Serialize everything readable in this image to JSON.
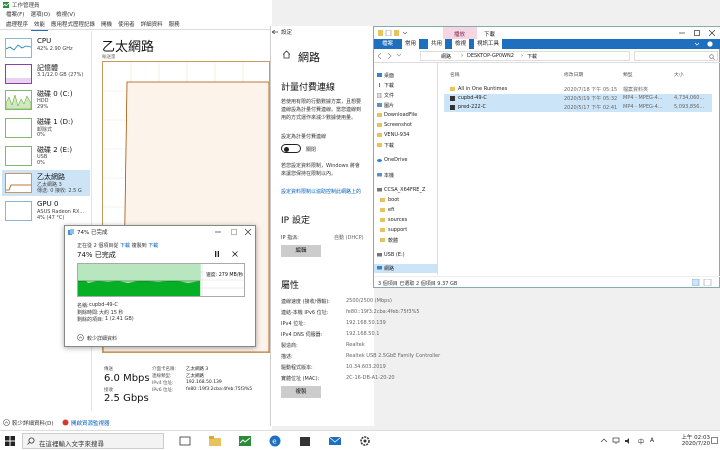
{
  "task_manager": {
    "title": "工作管理員",
    "menu": [
      "檔案(F)",
      "選項(O)",
      "檢視(V)"
    ],
    "tabs": [
      "處理程序",
      "效能",
      "應用程式歷程記錄",
      "開機",
      "使用者",
      "詳細資料",
      "服務"
    ],
    "sidebar": [
      {
        "name": "CPU",
        "l2": "42% 2.90 GHz",
        "l3": ""
      },
      {
        "name": "記憶體",
        "l2": "3.1/12.0 GB (27%)",
        "l3": ""
      },
      {
        "name": "磁碟 0 (C:)",
        "l2": "HDD",
        "l3": "29%"
      },
      {
        "name": "磁碟 1 (D:)",
        "l2": "卸除式",
        "l3": "0%"
      },
      {
        "name": "磁碟 2 (E:)",
        "l2": "USB",
        "l3": "0%"
      },
      {
        "name": "乙太網路",
        "l2": "乙太網路 3",
        "l3": "傳送: 0 接收: 2.5 G"
      },
      {
        "name": "GPU 0",
        "l2": "ASUS Radeon RX...",
        "l3": "4% (47 °C)"
      }
    ],
    "main_title": "乙太網路",
    "graph_label": "輸送量",
    "stats": {
      "send_label": "傳送",
      "send_value": "6.0 Mbps",
      "recv_label": "接收",
      "recv_value": "2.5 Gbps",
      "details": [
        {
          "k": "介面卡名稱:",
          "v": "乙太網路 3"
        },
        {
          "k": "連線類型:",
          "v": "乙太網路"
        },
        {
          "k": "IPv4 位址:",
          "v": "192.168.50.139"
        },
        {
          "k": "IPv6 位址:",
          "v": "fe80::19f3:2cba:4feb:75f3%5"
        }
      ]
    },
    "bottom": {
      "less": "較少詳細資料(D)",
      "resmon": "開啟資源監視器"
    }
  },
  "copy_dialog": {
    "title": "74% 已完成",
    "line1_a": "正在從 2 個項目從",
    "line1_src": "下載",
    "line1_b": "複製到",
    "line1_dst": "下載",
    "percent": "74% 已完成",
    "progress": 0.74,
    "speed": "速度: 279 MB/秒",
    "name_label": "名稱:",
    "name_value": "cupbd-49-C",
    "time_label": "剩餘時間:",
    "time_value": "大約 15 秒",
    "items_label": "剩餘的項目:",
    "items_value": "1 (2.41 GB)",
    "less": "較少詳細資料"
  },
  "settings": {
    "title": "設定",
    "page": "網路",
    "h_metered": "計量付費連線",
    "p1": "若使用有限的行動數據方案，且想要",
    "p2": "連線設為計量付費連線。當您連線到",
    "p3": "用的方式運作來減少數據使用量。",
    "metered_q": "設定為計量付費連線",
    "toggle": "關閉",
    "p4": "若您設定資料限制，Windows 將會",
    "p5": "來讓您保持在限制以內。",
    "link": "設定資料限制以協助控制此網路上的",
    "h_ip": "IP 設定",
    "ip_assign_k": "IP 指派:",
    "ip_assign_v": "自動 (DHCP)",
    "edit": "編輯",
    "h_props": "屬性",
    "props": [
      {
        "k": "連線速度 (接收/傳輸):",
        "v": "2500/2500 (Mbps)"
      },
      {
        "k": "連結-本機 IPv6 位址:",
        "v": "fe80::19f3:2cba:4feb:75f3%5"
      },
      {
        "k": "IPv4 位址:",
        "v": "192.168.50.139"
      },
      {
        "k": "IPv4 DNS 伺服器:",
        "v": "192.168.50.1"
      },
      {
        "k": "製造商:",
        "v": "Realtek"
      },
      {
        "k": "描述:",
        "v": "Realtek USB 2.5GbE Family Controller"
      },
      {
        "k": "驅動程式版本:",
        "v": "10.34.603.2019"
      },
      {
        "k": "實體位址 (MAC):",
        "v": "2C-16-DB-A1-20-20"
      }
    ],
    "copy": "複製"
  },
  "explorer": {
    "title": "下載",
    "play_tab": "播放",
    "ribbon": [
      "檔案",
      "常用",
      "共用",
      "檢視",
      "視訊工具"
    ],
    "path": [
      "網路",
      "DESKTOP-GP0WN2",
      "下載"
    ],
    "columns": [
      "名稱",
      "修改日期",
      "類型",
      "大小"
    ],
    "files": [
      {
        "name": "All in One Runtimes",
        "date": "2020/7/18 下午 05:15",
        "type": "檔案資料夾",
        "size": ""
      },
      {
        "name": "cupbd-49-C",
        "date": "2020/5/19 下午 05:32",
        "type": "MP4 - MPEG-4...",
        "size": "4,734,060..."
      },
      {
        "name": "pred-222-C",
        "date": "2020/5/17 下午 02:41",
        "type": "MP4 - MPEG-4...",
        "size": "5,093,856..."
      }
    ],
    "nav": [
      "桌面",
      "下載",
      "文件",
      "圖片",
      "DownloadFile",
      "Screenshot",
      "VENU-934",
      "下載",
      "OneDrive",
      "本機",
      "CCSA_X64FRE_Z",
      "boot",
      "efi",
      "sources",
      "support",
      "軟體",
      "USB (E:)",
      "網路"
    ],
    "status": "3 個項目    已選取 2 個項目  9.37 GB"
  },
  "taskbar": {
    "search_placeholder": "在這裡輸入文字來搜尋",
    "time": "上午 02:03",
    "date": "2020/7/20",
    "ime": "中",
    "lang": "A"
  },
  "colors": {
    "accent": "#1e70bf",
    "cpu": "#117dbb",
    "disk": "#4da60c",
    "net": "#a74f01",
    "copy_fill": "#06b025"
  }
}
